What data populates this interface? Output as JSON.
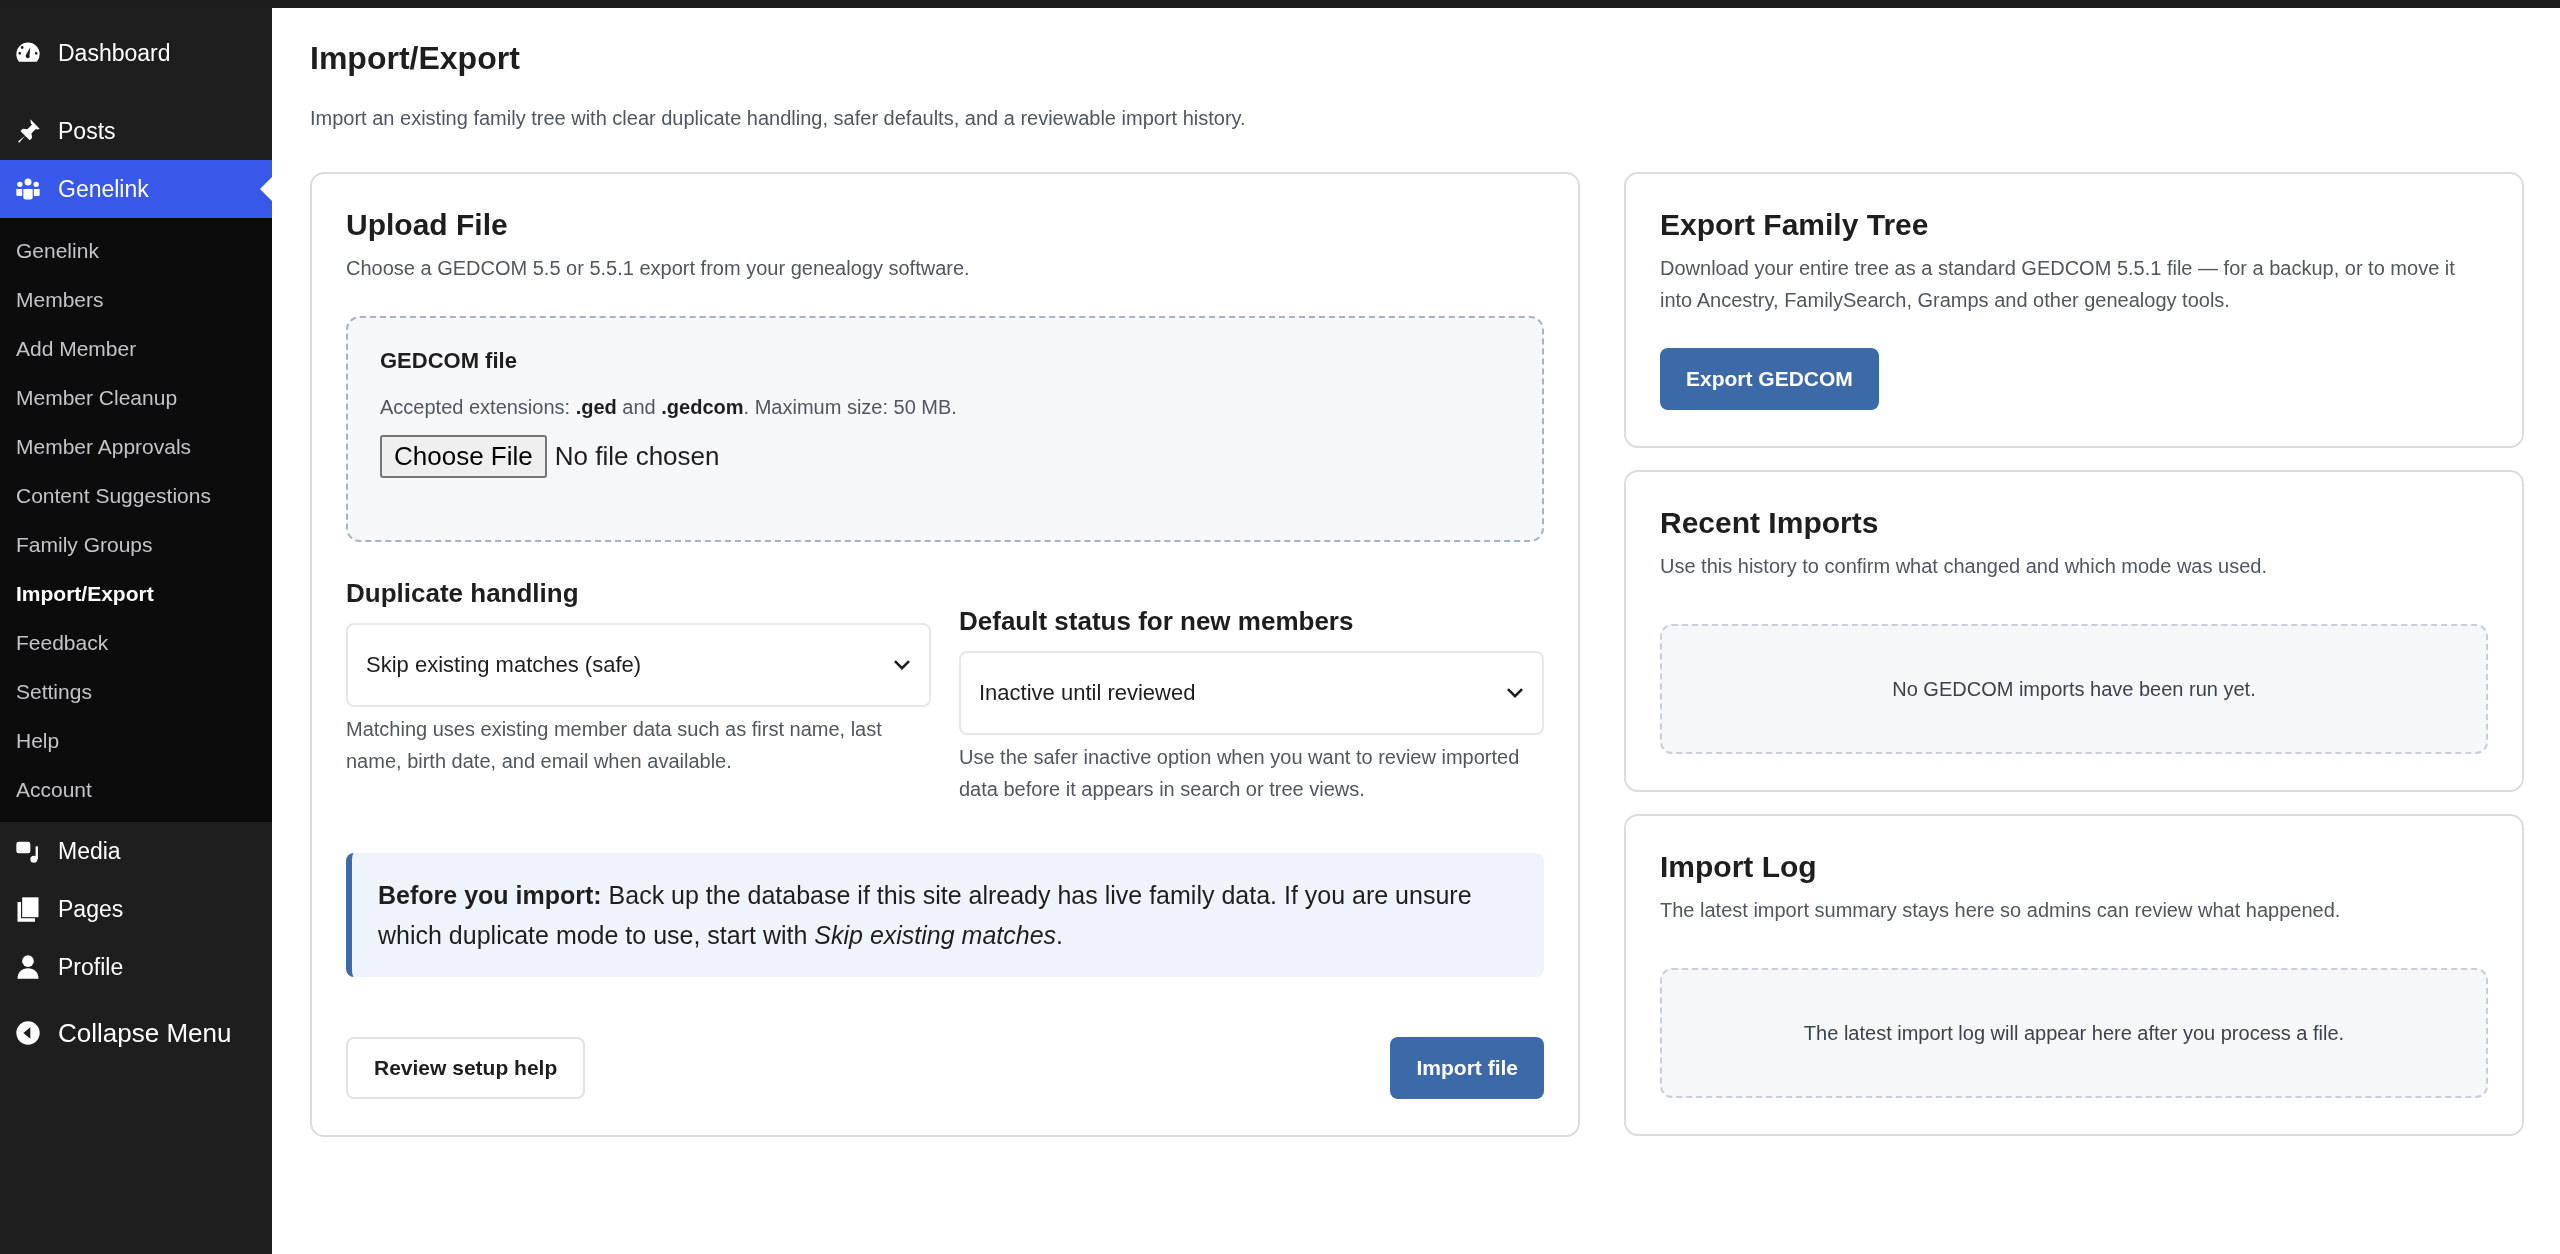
{
  "sidebar": {
    "items": [
      {
        "label": "Dashboard",
        "selected": false
      },
      {
        "label": "Posts",
        "selected": false
      },
      {
        "label": "Genelink",
        "selected": true,
        "children": [
          {
            "label": "Genelink",
            "selected": false
          },
          {
            "label": "Members",
            "selected": false
          },
          {
            "label": "Add Member",
            "selected": false
          },
          {
            "label": "Member Cleanup",
            "selected": false
          },
          {
            "label": "Member Approvals",
            "selected": false
          },
          {
            "label": "Content Suggestions",
            "selected": false
          },
          {
            "label": "Family Groups",
            "selected": false
          },
          {
            "label": "Import/Export",
            "selected": true
          },
          {
            "label": "Feedback",
            "selected": false
          },
          {
            "label": "Settings",
            "selected": false
          },
          {
            "label": "Help",
            "selected": false
          },
          {
            "label": "Account",
            "selected": false
          }
        ]
      },
      {
        "label": "Media",
        "selected": false
      },
      {
        "label": "Pages",
        "selected": false
      },
      {
        "label": "Profile",
        "selected": false
      }
    ],
    "collapse": "Collapse Menu"
  },
  "page": {
    "title": "Import/Export",
    "description": "Import an existing family tree with clear duplicate handling, safer defaults, and a reviewable import history."
  },
  "upload": {
    "title": "Upload File",
    "subtitle": "Choose a GEDCOM 5.5 or 5.5.1 export from your genealogy software.",
    "dropzone": {
      "label": "GEDCOM file",
      "hint": "Accepted extensions: **.ged** and **.gedcom**. Maximum size: 50 MB.",
      "button": "Choose File",
      "status": "No file chosen"
    },
    "fields": [
      {
        "label": "Duplicate handling",
        "value": "Skip existing matches (safe)",
        "help": "Matching uses existing member data such as first name, last name, birth date, and email when available."
      },
      {
        "label": "Default status for new members",
        "value": "Inactive until reviewed",
        "help": "Use the safer inactive option when you want to review imported data before it appears in search or tree views."
      }
    ],
    "notice": "**Before you import:** Back up the database if this site already has live family data. If you are unsure which duplicate mode to use, start with *Skip existing matches*.",
    "secondary_button": "Review setup help",
    "primary_button": "Import file"
  },
  "export": {
    "title": "Export Family Tree",
    "text": "Download your entire tree as a standard GEDCOM 5.5.1 file — for a backup, or to move it into Ancestry, FamilySearch, Gramps and other genealogy tools.",
    "button": "Export GEDCOM"
  },
  "recent_imports": {
    "title": "Recent Imports",
    "text": "Use this history to confirm what changed and which mode was used.",
    "empty": "No GEDCOM imports have been run yet."
  },
  "import_log": {
    "title": "Import Log",
    "text": "The latest import summary stays here so admins can review what happened.",
    "empty": "The latest import log will appear here after you process a file."
  }
}
